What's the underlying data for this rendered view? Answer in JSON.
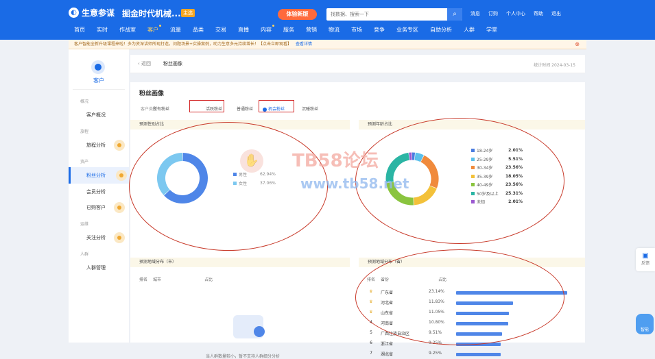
{
  "topbar": {
    "app_name": "生意参谋",
    "shop_name": "掘金时代机械...",
    "shop_tag": "主选",
    "new_version": "体验新版",
    "search_placeholder": "找数据、搜索一下",
    "links": [
      "消息",
      "订购",
      "个人中心",
      "帮助",
      "退出"
    ]
  },
  "nav": [
    "首页",
    "实时",
    "作战室",
    "客户",
    "流量",
    "品类",
    "交易",
    "直播",
    "内容",
    "服务",
    "营销",
    "物流",
    "市场",
    "竞争",
    "业务专区",
    "自助分析",
    "人群",
    "学堂"
  ],
  "nav_active": "客户",
  "notice": {
    "text": "客户智能全新升级课程来啦！多为资深讲师所现打造，问题场景+实操案例，助力生意多元持续增长！【点击立即观看】",
    "link": "查看详情"
  },
  "sidebar": {
    "title": "客户",
    "groups": [
      {
        "label": "概况",
        "items": [
          "客户概况"
        ]
      },
      {
        "label": "旅程",
        "items": [
          "旅程分析"
        ]
      },
      {
        "label": "资产",
        "items": [
          "粉丝分析",
          "会员分析",
          "已购客户"
        ]
      },
      {
        "label": "运维",
        "items": [
          "关注分析"
        ]
      },
      {
        "label": "人群",
        "items": [
          "人群管理"
        ]
      }
    ],
    "active": "粉丝分析"
  },
  "header": {
    "back": "返回",
    "crumb": "粉丝画像",
    "stat_time": "统计时间 2024-03-15"
  },
  "card": {
    "title": "粉丝画像",
    "filter_label": "客户类型",
    "filter_tabs": [
      "所有粉丝",
      "活跃粉丝",
      "普通粉丝",
      "机会粉丝",
      "沉睡粉丝"
    ],
    "filter_selected": "机会粉丝"
  },
  "gender_panel": {
    "title": "预测性别占比",
    "items": [
      {
        "label": "男性",
        "value": "62.94%",
        "color": "#4f86e8"
      },
      {
        "label": "女性",
        "value": "37.06%",
        "color": "#7cc8f0"
      }
    ]
  },
  "age_panel": {
    "title": "预测年龄占比",
    "items": [
      {
        "label": "18-24岁",
        "value": "2.01%",
        "pct": 2.01,
        "color": "#4a7de0"
      },
      {
        "label": "25-29岁",
        "value": "5.51%",
        "pct": 5.51,
        "color": "#5bc0eb"
      },
      {
        "label": "30-34岁",
        "value": "23.56%",
        "pct": 23.56,
        "color": "#f08a3c"
      },
      {
        "label": "35-39岁",
        "value": "18.05%",
        "pct": 18.05,
        "color": "#f3c13a"
      },
      {
        "label": "40-49岁",
        "value": "23.56%",
        "pct": 23.56,
        "color": "#8ac43f"
      },
      {
        "label": "50岁及以上",
        "value": "25.31%",
        "pct": 25.31,
        "color": "#2bb5a4"
      },
      {
        "label": "未知",
        "value": "2.01%",
        "pct": 2.01,
        "color": "#9b59d0"
      }
    ]
  },
  "city_panel": {
    "title": "预测地域分布（市）",
    "headers": [
      "排名",
      "城市",
      "占比"
    ],
    "empty_text": "当人群数量较小，暂不支持人群细分分析"
  },
  "province_panel": {
    "title": "预测地域分布（省）",
    "headers": [
      "排名",
      "省份",
      "占比"
    ],
    "rows": [
      {
        "rank": "1",
        "name": "广东省",
        "value": "23.14%",
        "pct": 23.14
      },
      {
        "rank": "2",
        "name": "河北省",
        "value": "11.83%",
        "pct": 11.83
      },
      {
        "rank": "3",
        "name": "山东省",
        "value": "11.05%",
        "pct": 11.05
      },
      {
        "rank": "4",
        "name": "河南省",
        "value": "10.80%",
        "pct": 10.8
      },
      {
        "rank": "5",
        "name": "广西壮族自治区",
        "value": "9.51%",
        "pct": 9.51
      },
      {
        "rank": "6",
        "name": "浙江省",
        "value": "9.25%",
        "pct": 9.25
      },
      {
        "rank": "7",
        "name": "湖北省",
        "value": "9.25%",
        "pct": 9.25
      }
    ]
  },
  "watermark": {
    "line1": "TB58论坛",
    "line2": "www.tb58.net"
  },
  "float": {
    "feedback": "反馈",
    "assistant": "智能"
  }
}
